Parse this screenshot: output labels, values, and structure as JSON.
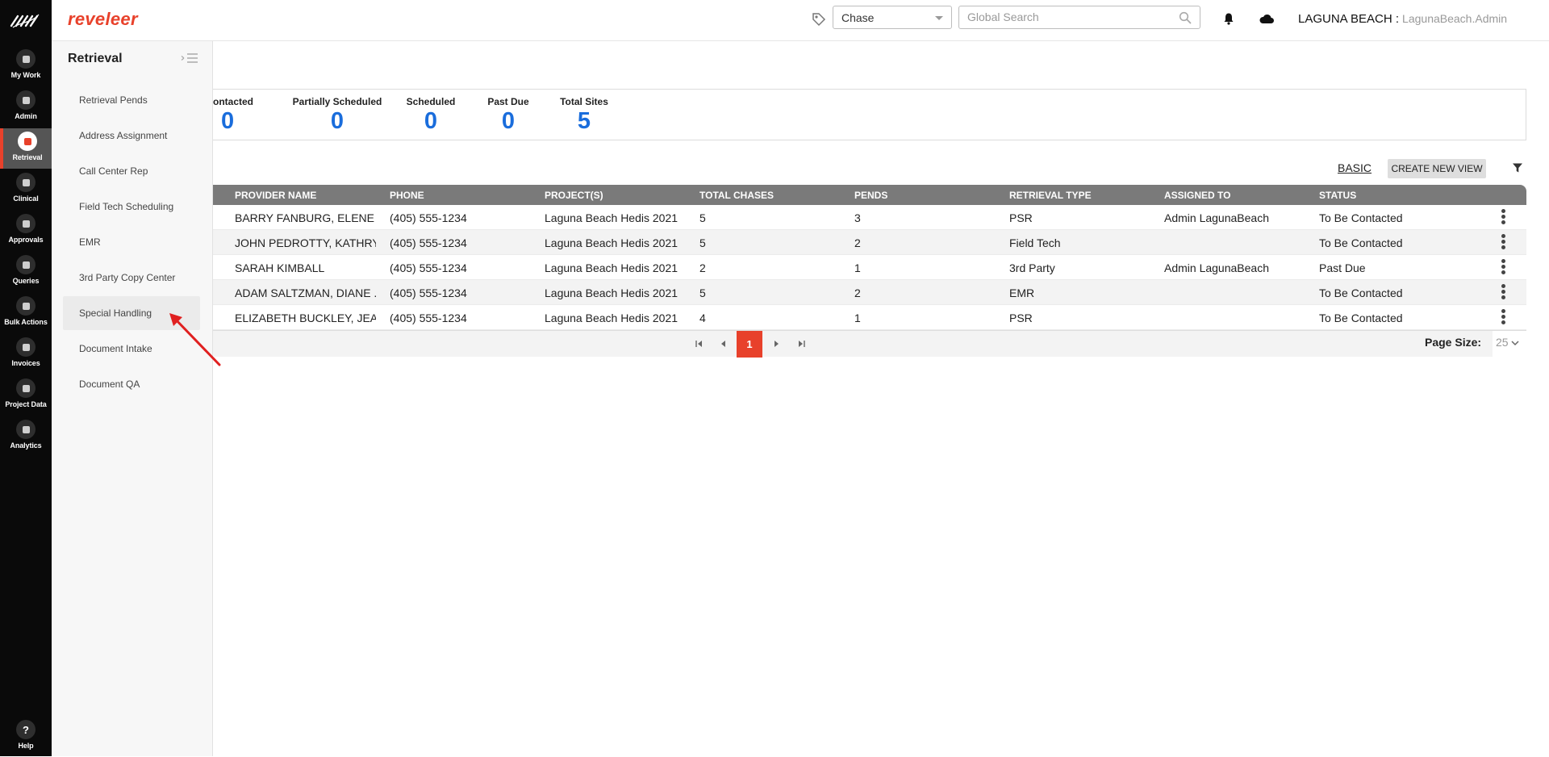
{
  "rail": {
    "items": [
      {
        "label": "My Work",
        "icon": "home-icon"
      },
      {
        "label": "Admin",
        "icon": "gear-icon"
      },
      {
        "label": "Retrieval",
        "icon": "arrow-right-circle-icon",
        "active": true
      },
      {
        "label": "Clinical",
        "icon": "clipboard-icon"
      },
      {
        "label": "Approvals",
        "icon": "list-icon"
      },
      {
        "label": "Queries",
        "icon": "document-icon"
      },
      {
        "label": "Bulk Actions",
        "icon": "layers-icon"
      },
      {
        "label": "Invoices",
        "icon": "dollar-icon"
      },
      {
        "label": "Project Data",
        "icon": "grid-icon"
      },
      {
        "label": "Analytics",
        "icon": "bar-chart-icon"
      }
    ],
    "help_label": "Help",
    "help_icon": "?"
  },
  "header": {
    "brand": "reveleer",
    "select_value": "Chase",
    "search_placeholder": "Global Search",
    "org": "LAGUNA BEACH :",
    "user": "LagunaBeach.Admin"
  },
  "subnav": {
    "title": "Retrieval",
    "items": [
      "Retrieval Pends",
      "Address Assignment",
      "Call Center Rep",
      "Field Tech Scheduling",
      "EMR",
      "3rd Party Copy Center",
      "Special Handling",
      "Document Intake",
      "Document QA"
    ],
    "highlighted": "Special Handling"
  },
  "stats": [
    {
      "label": "ontacted",
      "value": "0"
    },
    {
      "label": "Partially Scheduled",
      "value": "0"
    },
    {
      "label": "Scheduled",
      "value": "0"
    },
    {
      "label": "Past Due",
      "value": "0"
    },
    {
      "label": "Total Sites",
      "value": "5"
    }
  ],
  "toolbar": {
    "basic_label": "BASIC",
    "create_label": "CREATE NEW VIEW"
  },
  "table": {
    "columns": [
      "PROVIDER NAME",
      "PHONE",
      "PROJECT(S)",
      "TOTAL CHASES",
      "PENDS",
      "RETRIEVAL TYPE",
      "ASSIGNED TO",
      "STATUS"
    ],
    "rows": [
      {
        "provider": "BARRY FANBURG, ELENE ...",
        "phone": "(405) 555-1234",
        "project": "Laguna Beach Hedis 2021",
        "total": "5",
        "pends": "3",
        "type": "PSR",
        "assigned": "Admin LagunaBeach",
        "status": "To Be Contacted"
      },
      {
        "provider": "JOHN PEDROTTY, KATHRY...",
        "phone": "(405) 555-1234",
        "project": "Laguna Beach Hedis 2021",
        "total": "5",
        "pends": "2",
        "type": "Field Tech",
        "assigned": "",
        "status": "To Be Contacted"
      },
      {
        "provider": "SARAH KIMBALL",
        "phone": "(405) 555-1234",
        "project": "Laguna Beach Hedis 2021",
        "total": "2",
        "pends": "1",
        "type": "3rd Party",
        "assigned": "Admin LagunaBeach",
        "status": "Past Due"
      },
      {
        "provider": "ADAM SALTZMAN, DIANE ...",
        "phone": "(405) 555-1234",
        "project": "Laguna Beach Hedis 2021",
        "total": "5",
        "pends": "2",
        "type": "EMR",
        "assigned": "",
        "status": "To Be Contacted"
      },
      {
        "provider": "ELIZABETH BUCKLEY, JEA...",
        "phone": "(405) 555-1234",
        "project": "Laguna Beach Hedis 2021",
        "total": "4",
        "pends": "1",
        "type": "PSR",
        "assigned": "",
        "status": "To Be Contacted"
      }
    ]
  },
  "pager": {
    "current_page": "1",
    "page_size_label": "Page Size:",
    "page_size": "25"
  },
  "colors": {
    "accent": "#e8412b",
    "stat_value": "#1a6ddc",
    "rail_bg": "#0a0a0a",
    "table_header": "#7a7a7a"
  }
}
